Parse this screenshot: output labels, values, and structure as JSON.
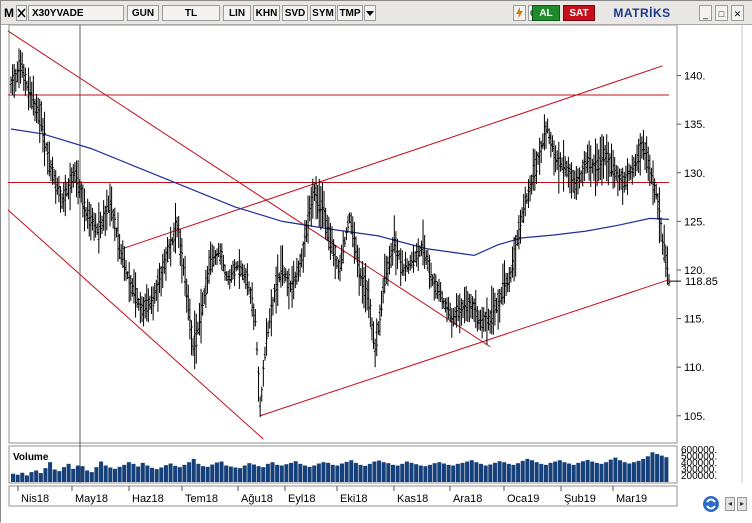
{
  "toolbar": {
    "menu_letter": "M",
    "symbol": "X30YVADE",
    "period": "GUN",
    "currency": "TL",
    "scale": "LIN",
    "buttons": [
      "KHN",
      "SVD",
      "SYM",
      "TMP"
    ],
    "buy": "AL",
    "sell": "SAT",
    "brand": "MATRİKS",
    "window_controls": [
      "_",
      "□",
      "✕"
    ]
  },
  "colors": {
    "price_bar": "#000000",
    "trend_lines": "#c0101c",
    "moving_average": "#1f2f9a",
    "volume": "#16407a",
    "grid_vertical": "#606060"
  },
  "chart_data": {
    "type": "ohlc",
    "symbol": "X30YVADE",
    "last_value": "118.85",
    "y_ticks": [
      105,
      110,
      115,
      120,
      125,
      130,
      135,
      140
    ],
    "y_tick_labels": [
      "105.",
      "110.",
      "115.",
      "120.",
      "125.",
      "130.",
      "135.",
      "140."
    ],
    "ylim": [
      102.2,
      145.2
    ],
    "x_tick_labels": [
      "Nis18",
      "May18",
      "Haz18",
      "Tem18",
      "Ağu18",
      "Eyl18",
      "Eki18",
      "Kas18",
      "Ara18",
      "Oca19",
      "Şub19",
      "Mar19"
    ],
    "price_path": [
      [
        0,
        139
      ],
      [
        6,
        141
      ],
      [
        12,
        138
      ],
      [
        18,
        136
      ],
      [
        24,
        131
      ],
      [
        32,
        127
      ],
      [
        40,
        130
      ],
      [
        48,
        125.5
      ],
      [
        55,
        124
      ],
      [
        62,
        127
      ],
      [
        70,
        121
      ],
      [
        76,
        118
      ],
      [
        82,
        116
      ],
      [
        88,
        116.5
      ],
      [
        96,
        120.5
      ],
      [
        104,
        124.5
      ],
      [
        110,
        118
      ],
      [
        114,
        112
      ],
      [
        118,
        114.5
      ],
      [
        124,
        120.5
      ],
      [
        130,
        122
      ],
      [
        136,
        119
      ],
      [
        142,
        120.5
      ],
      [
        148,
        119
      ],
      [
        153,
        115
      ],
      [
        156,
        105.5
      ],
      [
        160,
        113
      ],
      [
        166,
        118.5
      ],
      [
        170,
        120
      ],
      [
        176,
        118
      ],
      [
        182,
        121
      ],
      [
        186,
        125
      ],
      [
        190,
        128
      ],
      [
        196,
        126
      ],
      [
        200,
        123
      ],
      [
        206,
        120
      ],
      [
        212,
        125.5
      ],
      [
        218,
        120
      ],
      [
        224,
        117
      ],
      [
        228,
        111.5
      ],
      [
        234,
        119
      ],
      [
        240,
        123
      ],
      [
        246,
        120
      ],
      [
        252,
        121
      ],
      [
        258,
        122.5
      ],
      [
        264,
        119
      ],
      [
        270,
        117
      ],
      [
        276,
        115
      ],
      [
        282,
        116
      ],
      [
        288,
        116.5
      ],
      [
        294,
        114.5
      ],
      [
        300,
        115
      ],
      [
        306,
        117
      ],
      [
        312,
        119
      ],
      [
        318,
        124
      ],
      [
        324,
        128
      ],
      [
        330,
        131.5
      ],
      [
        336,
        134.5
      ],
      [
        342,
        131
      ],
      [
        348,
        130.5
      ],
      [
        354,
        128.5
      ],
      [
        360,
        131
      ],
      [
        366,
        130.5
      ],
      [
        372,
        132
      ],
      [
        378,
        130
      ],
      [
        384,
        129
      ],
      [
        390,
        130.5
      ],
      [
        396,
        133
      ],
      [
        400,
        130
      ],
      [
        404,
        128
      ],
      [
        408,
        123
      ],
      [
        412,
        118.85
      ]
    ],
    "moving_average": [
      [
        0,
        134.5
      ],
      [
        20,
        134
      ],
      [
        50,
        132.5
      ],
      [
        80,
        130.5
      ],
      [
        110,
        128.5
      ],
      [
        140,
        126.5
      ],
      [
        170,
        125
      ],
      [
        200,
        124.2
      ],
      [
        230,
        123.5
      ],
      [
        260,
        122.2
      ],
      [
        290,
        121.5
      ],
      [
        305,
        122.6
      ],
      [
        320,
        123.3
      ],
      [
        340,
        123.6
      ],
      [
        360,
        124
      ],
      [
        380,
        124.6
      ],
      [
        400,
        125.3
      ],
      [
        412,
        125.2
      ]
    ],
    "volume_axis_labels": [
      "600000.",
      "500000.",
      "400000.",
      "300000.",
      "200000."
    ],
    "volume_label": "Volume",
    "volume_values": [
      0.25,
      0.22,
      0.28,
      0.2,
      0.3,
      0.35,
      0.27,
      0.42,
      0.6,
      0.38,
      0.33,
      0.45,
      0.55,
      0.4,
      0.5,
      0.48,
      0.35,
      0.3,
      0.45,
      0.62,
      0.5,
      0.44,
      0.4,
      0.46,
      0.52,
      0.6,
      0.55,
      0.47,
      0.58,
      0.5,
      0.43,
      0.39,
      0.44,
      0.51,
      0.56,
      0.49,
      0.45,
      0.52,
      0.6,
      0.7,
      0.55,
      0.48,
      0.46,
      0.53,
      0.59,
      0.62,
      0.5,
      0.47,
      0.44,
      0.42,
      0.5,
      0.57,
      0.53,
      0.48,
      0.45,
      0.55,
      0.6,
      0.52,
      0.5,
      0.54,
      0.58,
      0.63,
      0.55,
      0.5,
      0.46,
      0.5,
      0.56,
      0.6,
      0.58,
      0.52,
      0.5,
      0.56,
      0.61,
      0.66,
      0.58,
      0.52,
      0.49,
      0.55,
      0.62,
      0.65,
      0.6,
      0.57,
      0.52,
      0.5,
      0.55,
      0.62,
      0.58,
      0.54,
      0.5,
      0.48,
      0.52,
      0.57,
      0.6,
      0.56,
      0.52,
      0.5,
      0.55,
      0.58,
      0.62,
      0.66,
      0.6,
      0.55,
      0.5,
      0.53,
      0.58,
      0.63,
      0.6,
      0.55,
      0.52,
      0.57,
      0.64,
      0.7,
      0.66,
      0.6,
      0.55,
      0.52,
      0.58,
      0.62,
      0.66,
      0.6,
      0.56,
      0.52,
      0.58,
      0.63,
      0.67,
      0.62,
      0.58,
      0.55,
      0.6,
      0.68,
      0.74,
      0.66,
      0.6,
      0.56,
      0.6,
      0.64,
      0.7,
      0.78,
      0.9,
      0.85,
      0.8,
      0.75
    ],
    "trend_lines_price": [
      {
        "from": [
          -2,
          144.6
        ],
        "to": [
          300,
          112.1
        ]
      },
      {
        "from": [
          -2,
          126.2
        ],
        "to": [
          158,
          102.6
        ]
      },
      {
        "from": [
          156,
          105.0
        ],
        "to": [
          412,
          119.0
        ]
      },
      {
        "from": [
          70,
          122.2
        ],
        "to": [
          408,
          141.0
        ]
      },
      {
        "from": [
          -2,
          138.0
        ],
        "to": [
          412,
          138.0
        ]
      },
      {
        "from": [
          -2,
          129.0
        ],
        "to": [
          412,
          129.0
        ]
      }
    ]
  }
}
